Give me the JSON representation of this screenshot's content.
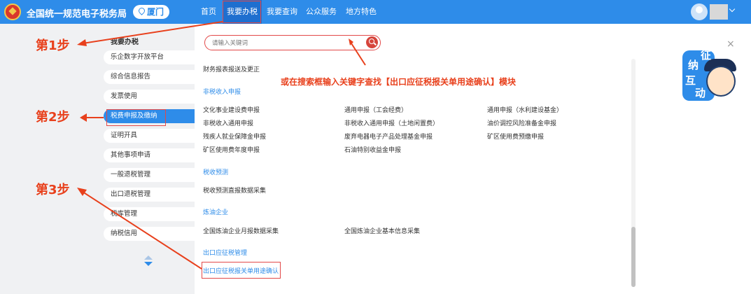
{
  "header": {
    "title": "全国统一规范电子税务局",
    "location": "厦门",
    "nav": [
      "首页",
      "我要办税",
      "我要查询",
      "公众服务",
      "地方特色"
    ],
    "active_nav": "我要办税"
  },
  "sidebar": {
    "heading": "我要办税",
    "items": [
      {
        "label": "乐企数字开放平台"
      },
      {
        "label": "综合信息报告"
      },
      {
        "label": "发票使用"
      },
      {
        "label": "税费申报及缴纳",
        "selected": true
      },
      {
        "label": "证明开具"
      },
      {
        "label": "其他事项申请"
      },
      {
        "label": "一般退税管理"
      },
      {
        "label": "出口退税管理"
      },
      {
        "label": "税库管理"
      },
      {
        "label": "纳税信用"
      }
    ]
  },
  "panel": {
    "search_placeholder": "请输入关键词",
    "close_label": "×",
    "top_item": "财务报表报送及更正",
    "sections": [
      {
        "title": "非税收入申报",
        "items": [
          "文化事业建设费申报",
          "通用申报（工会经费）",
          "通用申报（水利建设基金）",
          "非税收入通用申报",
          "非税收入通用申报（土地闲置费）",
          "油价调控风险准备金申报",
          "残疾人就业保障金申报",
          "废弃电器电子产品处理基金申报",
          "矿区使用费预缴申报",
          "矿区使用费年度申报",
          "石油特别收益金申报"
        ]
      },
      {
        "title": "税收预测",
        "items": [
          "税收预测直报数据采集"
        ]
      },
      {
        "title": "炼油企业",
        "items": [
          "全国炼油企业月报数据采集",
          "全国炼油企业基本信息采集"
        ]
      },
      {
        "title": "出口应征税管理",
        "items": [
          "出口应征税报关单用途确认"
        ]
      }
    ]
  },
  "mascot": {
    "chars": [
      "征",
      "纳",
      "互",
      "动"
    ]
  },
  "annotations": {
    "step1": "第1步",
    "step2": "第2步",
    "step3": "第3步",
    "tip": "或在搜索框输入关键字查找【出口应征税报关单用途确认】模块"
  },
  "colors": {
    "brand": "#2e8ce9",
    "annotation": "#e8401c",
    "highlight_box": "#e24848"
  }
}
